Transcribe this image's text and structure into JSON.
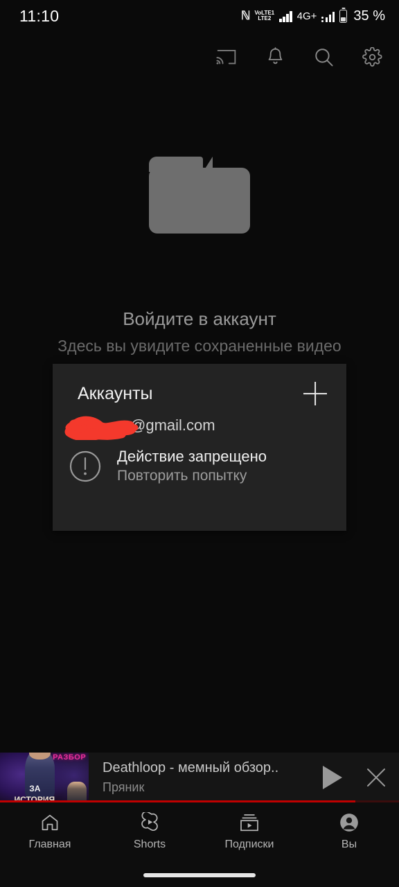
{
  "statusbar": {
    "time": "11:10",
    "nfc_icon": "nfc-icon",
    "volte_top": "VoLTE1",
    "volte_bottom": "LTE2",
    "signal_icon_1": "signal-bars-icon",
    "network_label": "4G+",
    "signal_icon_2": "signal-bars-icon",
    "battery_icon": "battery-icon",
    "battery_percent": "35 %"
  },
  "appbar": {
    "cast_label": "cast-icon",
    "notifications_label": "bell-icon",
    "search_label": "search-icon",
    "settings_label": "gear-icon"
  },
  "empty_state": {
    "icon": "folder-icon",
    "title": "Войдите в аккаунт",
    "subtitle": "Здесь вы увидите сохраненные видео",
    "folder_color": "#6e6e6e"
  },
  "dialog": {
    "title": "Аккаунты",
    "add_label": "plus-icon",
    "account": {
      "email_visible": "@gmail.com",
      "redacted": true,
      "redaction_color": "#f4392c"
    },
    "error": {
      "icon": "exclamation-circle-icon",
      "title": "Действие запрещено",
      "subtitle": "Повторить попытку"
    },
    "background_color": "#232323"
  },
  "miniplayer": {
    "thumbnail_texts": {
      "top": "РАЗБОР",
      "middle": "ЗА",
      "bottom": "ИСТОРИЯ"
    },
    "title": "Deathloop - мемный обзор..",
    "channel": "Пряник",
    "play_label": "play-icon",
    "close_label": "close-icon",
    "progress_percent": 89,
    "progress_color": "#c00000"
  },
  "bottomnav": {
    "items": [
      {
        "label": "Главная",
        "icon": "home-icon"
      },
      {
        "label": "Shorts",
        "icon": "shorts-icon"
      },
      {
        "label": "Подписки",
        "icon": "subscriptions-icon"
      },
      {
        "label": "Вы",
        "icon": "account-avatar-icon"
      }
    ]
  }
}
